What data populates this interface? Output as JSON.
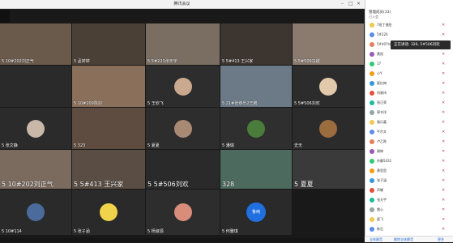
{
  "window": {
    "title": "腾讯会议"
  },
  "meeting": {
    "tiles": [
      {
        "label": "5 10#202刘正气",
        "big": false
      },
      {
        "label": "5 孟婷婷",
        "big": false
      },
      {
        "label": "5 5#223张天宇",
        "big": false
      },
      {
        "label": "5 5#413 王兴家",
        "big": false
      },
      {
        "label": "5 5#509冯越",
        "big": false
      },
      {
        "label": "",
        "big": false
      },
      {
        "label": "5 10#209陈迎",
        "big": false
      },
      {
        "label": "5 王欣飞",
        "big": false
      },
      {
        "label": "5 21#张恭乐2王鹏",
        "big": false
      },
      {
        "label": "5 5#506刘欢",
        "big": false
      },
      {
        "label": "5 张文静",
        "big": false
      },
      {
        "label": "5 323",
        "big": false
      },
      {
        "label": "5 夏夏",
        "big": false
      },
      {
        "label": "5 潘瑞",
        "big": false
      },
      {
        "label": "史无",
        "big": false
      },
      {
        "label": "5 10#202刘正气",
        "big": true
      },
      {
        "label": "5 5#413 王兴家",
        "big": true
      },
      {
        "label": "5 5#506刘欢",
        "big": true
      },
      {
        "label": "328",
        "big": true
      },
      {
        "label": "5 夏夏",
        "big": true
      },
      {
        "label": "5 10#114",
        "big": false
      },
      {
        "label": "5 张子涵",
        "big": false
      },
      {
        "label": "5 杨淑源",
        "big": false
      },
      {
        "label": "5 何雅琪",
        "big": false
      }
    ],
    "avatar_button": {
      "label": "鲁纯"
    }
  },
  "panel": {
    "header": "管理成员(33)",
    "subheader": "已入会",
    "tooltip": "正在讲话: 326, 5#506刘欢",
    "members": [
      "7班丁逸阳",
      "5#220",
      "5#407刘美雪",
      "黄阳",
      "17",
      "小Y",
      "夏红梅",
      "何湘诗",
      "屈正荣",
      "郭书洋",
      "骆乐嘉",
      "牛尔文",
      "卢乙陈",
      "谢婷",
      "孙静5431",
      "黄思思",
      "张子涵",
      "声嘟",
      "张天宇",
      "雷心",
      "夏飞",
      "陈石"
    ],
    "footer": {
      "left": "全体静音",
      "mid": "解除全体静音",
      "right": "更多"
    }
  },
  "colors": {
    "accent": "#1f6fe0",
    "mic_muted": "#d03c3c"
  }
}
